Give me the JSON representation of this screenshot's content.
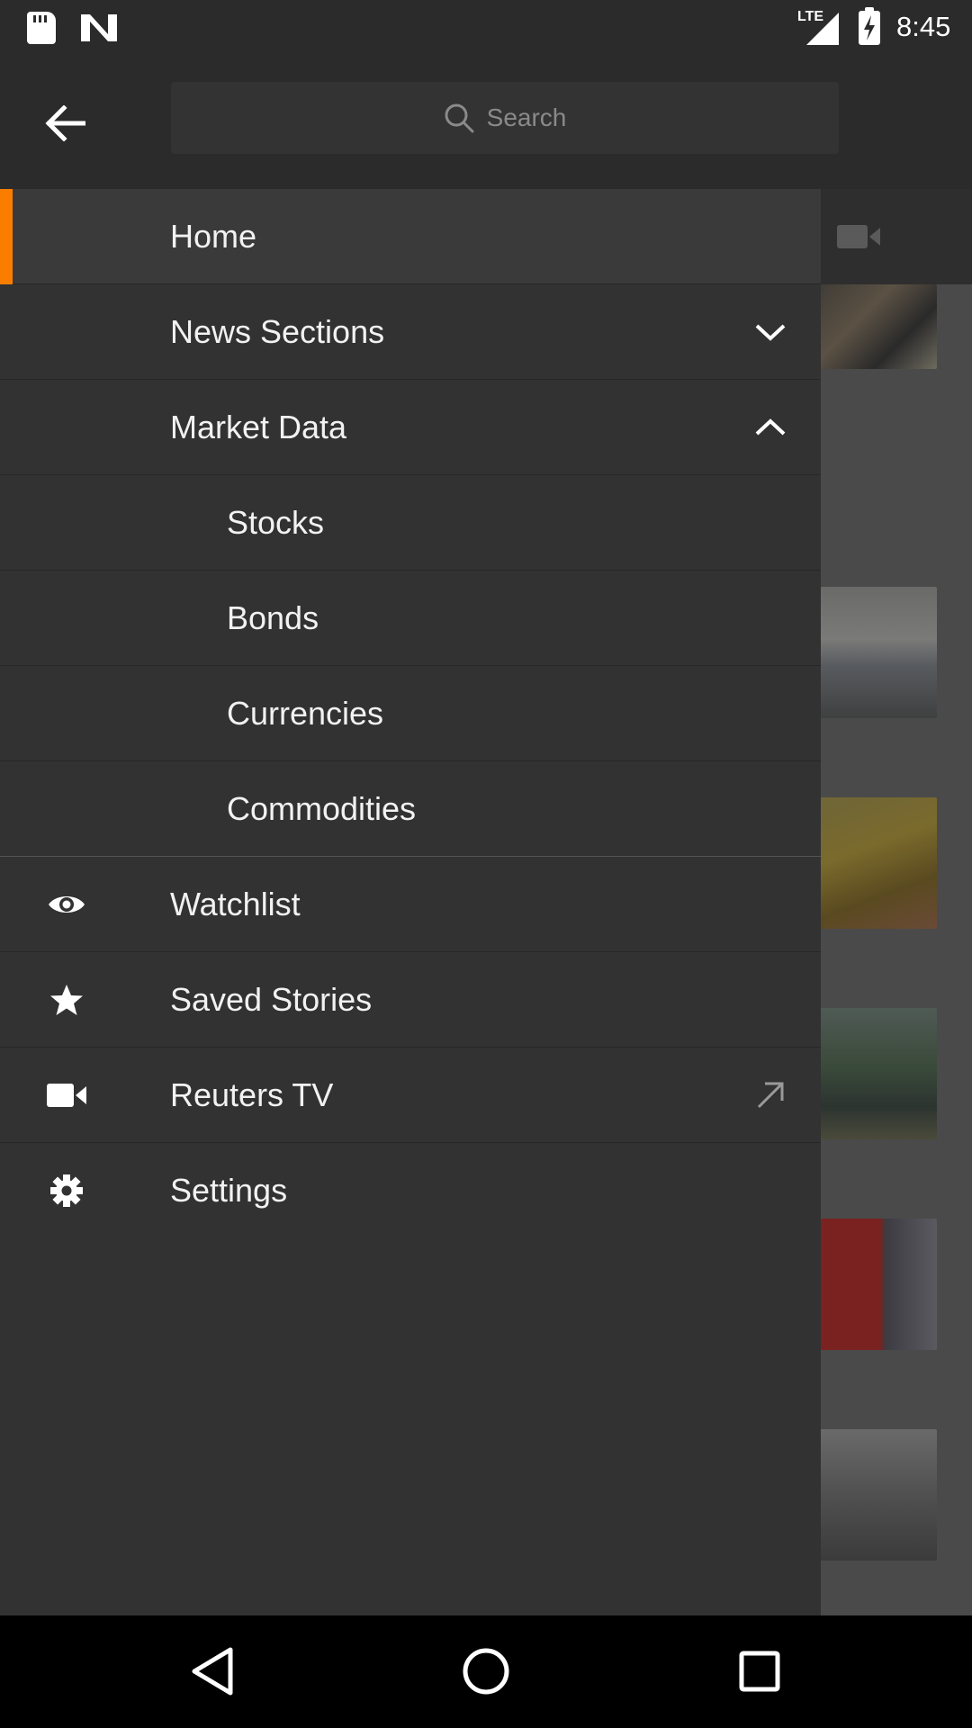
{
  "status_bar": {
    "network": "LTE",
    "time": "8:45"
  },
  "header": {
    "back_icon": "arrow-left-icon",
    "search": {
      "placeholder": "Search",
      "icon": "search-icon"
    }
  },
  "drawer": {
    "accent_color": "#fa7d00",
    "items": [
      {
        "label": "Home",
        "active": true
      },
      {
        "label": "News Sections",
        "trailing_icon": "chevron-down-icon"
      },
      {
        "label": "Market Data",
        "trailing_icon": "chevron-up-icon"
      },
      {
        "label": "Stocks",
        "sub": true
      },
      {
        "label": "Bonds",
        "sub": true
      },
      {
        "label": "Currencies",
        "sub": true
      },
      {
        "label": "Commodities",
        "sub": true
      },
      {
        "label": "Watchlist",
        "icon": "eye-icon"
      },
      {
        "label": "Saved Stories",
        "icon": "star-icon"
      },
      {
        "label": "Reuters TV",
        "icon": "video-camera-icon",
        "trailing_icon": "external-arrow-icon"
      },
      {
        "label": "Settings",
        "icon": "gear-icon"
      }
    ]
  },
  "nav_bar": {
    "back": "nav-back-icon",
    "home": "nav-home-icon",
    "recents": "nav-recents-icon"
  }
}
